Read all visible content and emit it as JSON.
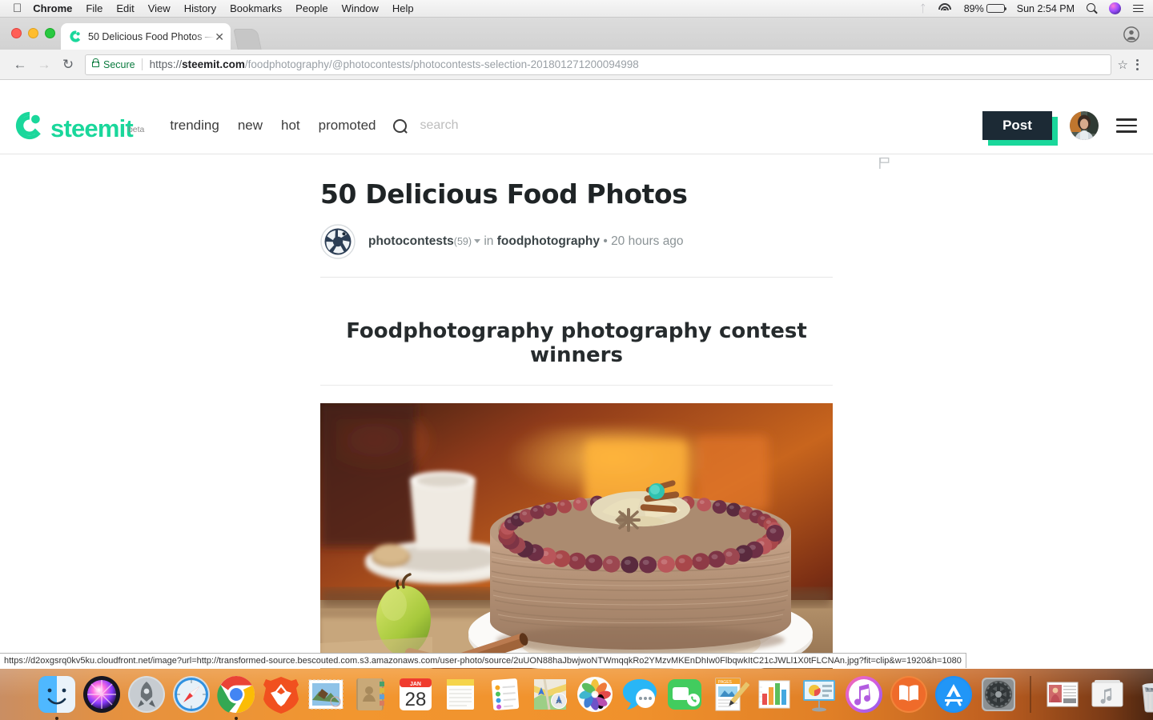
{
  "macbar": {
    "apple_icon": "apple-logo-icon",
    "menus": [
      "Chrome",
      "File",
      "Edit",
      "View",
      "History",
      "Bookmarks",
      "People",
      "Window",
      "Help"
    ],
    "status": {
      "bluetooth_icon": "bluetooth-icon",
      "wifi_icon": "wifi-icon",
      "battery_percent": "89%",
      "battery_icon": "battery-icon",
      "clock": "Sun 2:54 PM",
      "spotlight_icon": "spotlight-search-icon",
      "siri_icon": "siri-icon",
      "control_center_icon": "notification-center-icon"
    }
  },
  "browser": {
    "tab": {
      "title": "50 Delicious Food Photos — St",
      "favicon": "steemit-favicon",
      "close_icon": "close-tab-icon",
      "new_tab_icon": "new-tab-icon"
    },
    "profile_icon": "chrome-profile-icon",
    "nav": {
      "back_icon": "back-arrow-icon",
      "forward_icon": "forward-arrow-icon",
      "reload_icon": "reload-icon"
    },
    "omnibox": {
      "lock_icon": "lock-icon",
      "secure_label": "Secure",
      "url_scheme": "https://",
      "url_domain": "steemit.com",
      "url_path": "/foodphotography/@photocontests/photocontests-selection-201801271200094998",
      "bookmark_icon": "star-bookmark-icon",
      "menu_icon": "chrome-menu-icon"
    }
  },
  "site": {
    "logo_text": "steemit",
    "logo_sub": "beta",
    "logo_icon": "steemit-logo-icon",
    "nav": [
      {
        "label": "trending"
      },
      {
        "label": "new"
      },
      {
        "label": "hot"
      },
      {
        "label": "promoted"
      }
    ],
    "search": {
      "icon": "search-icon",
      "placeholder": "search",
      "value": ""
    },
    "post_button": "Post",
    "avatar_icon": "user-avatar",
    "menu_icon": "hamburger-menu-icon",
    "accent_color": "#1ad79b",
    "post_button_bg": "#1c2a35"
  },
  "article": {
    "title": "50 Delicious Food Photos",
    "author_avatar_icon": "camera-aperture-avatar",
    "author": "photocontests",
    "reputation": "(59)",
    "caret_icon": "chevron-down-icon",
    "in_word": "in",
    "category": "foodphotography",
    "separator": "•",
    "age": "20 hours ago",
    "flag_icon": "flag-icon",
    "subheading": "Foodphotography photography contest winners",
    "image_alt": "chocolate cake with berries, coffee cup, green apple and cinnamon sticks"
  },
  "statusbar": {
    "url": "https://d2oxgsrq0kv5ku.cloudfront.net/image?url=http://transformed-source.bescouted.com.s3.amazonaws.com/user-photo/source/2uUON88haJbwjwoNTWmqqkRo2YMzvMKEnDhIw0FlbqwkItC21cJWLl1X0tFLCNAn.jpg?fit=clip&w=1920&h=1080"
  },
  "dock": {
    "items": [
      {
        "name": "finder",
        "running": true
      },
      {
        "name": "siri",
        "running": false
      },
      {
        "name": "launchpad",
        "running": false
      },
      {
        "name": "safari",
        "running": false
      },
      {
        "name": "chrome",
        "running": true
      },
      {
        "name": "brave",
        "running": false
      },
      {
        "name": "mail",
        "running": false
      },
      {
        "name": "contacts",
        "running": false
      },
      {
        "name": "calendar",
        "running": false,
        "month": "JAN",
        "day": "28"
      },
      {
        "name": "notes",
        "running": false
      },
      {
        "name": "reminders",
        "running": false
      },
      {
        "name": "maps",
        "running": false
      },
      {
        "name": "photos",
        "running": false
      },
      {
        "name": "messages",
        "running": false
      },
      {
        "name": "facetime",
        "running": false
      },
      {
        "name": "pages",
        "running": false
      },
      {
        "name": "numbers",
        "running": false
      },
      {
        "name": "keynote",
        "running": false
      },
      {
        "name": "itunes",
        "running": false
      },
      {
        "name": "ibooks",
        "running": false
      },
      {
        "name": "app-store",
        "running": false
      },
      {
        "name": "system-preferences",
        "running": false
      },
      {
        "name": "downloads-stack",
        "running": false
      },
      {
        "name": "music-folder",
        "running": false
      },
      {
        "name": "trash",
        "running": false
      }
    ]
  }
}
